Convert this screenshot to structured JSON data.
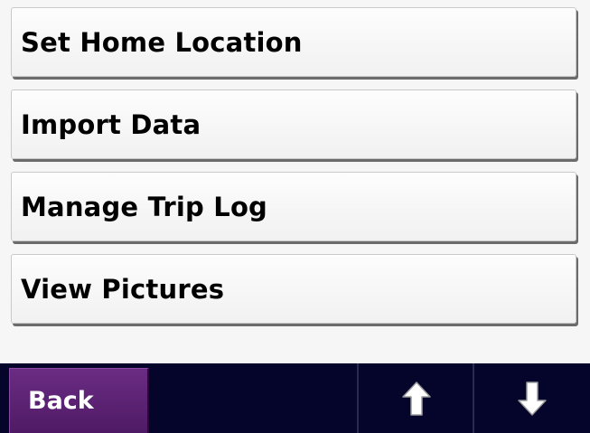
{
  "menu": {
    "items": [
      {
        "label": "Set Home Location"
      },
      {
        "label": "Import Data"
      },
      {
        "label": "Manage Trip Log"
      },
      {
        "label": "View Pictures"
      }
    ]
  },
  "bottom_bar": {
    "back_label": "Back",
    "up_icon": "arrow-up-icon",
    "down_icon": "arrow-down-icon"
  },
  "colors": {
    "background": "#f6f6f6",
    "bar": "#05042a",
    "back_button": "#5d2276",
    "text": "#000000"
  }
}
